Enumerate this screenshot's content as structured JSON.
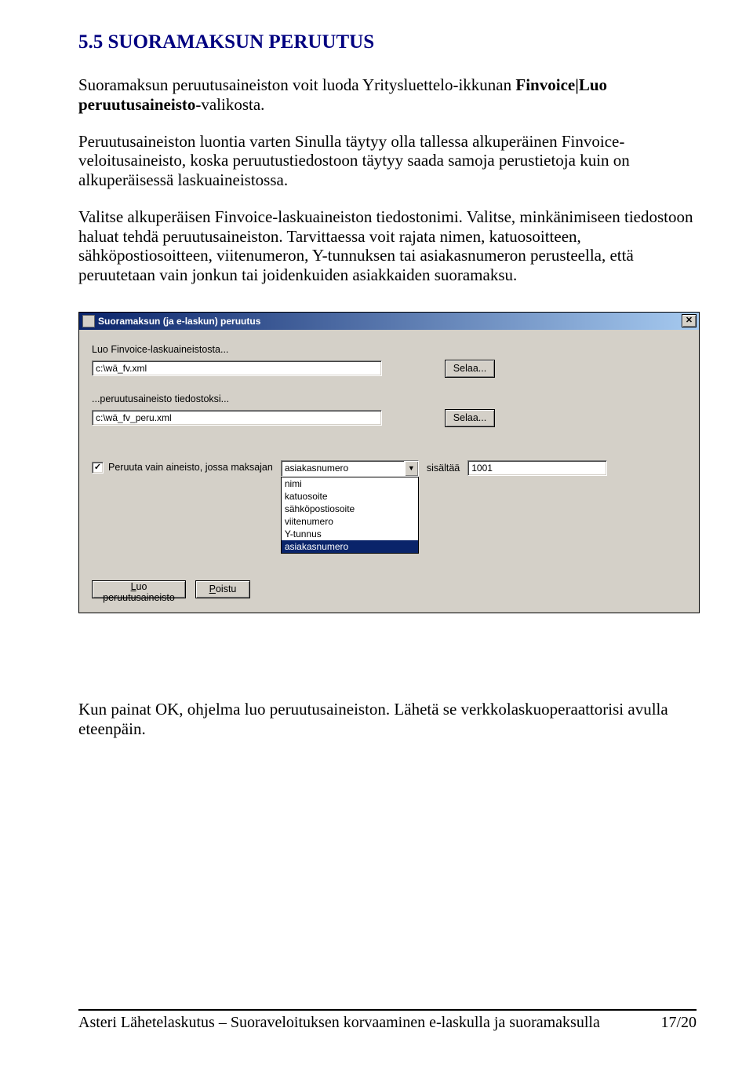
{
  "heading": "5.5 SUORAMAKSUN PERUUTUS",
  "para1_a": "Suoramaksun peruutusaineiston voit luoda Yritysluettelo-ikkunan ",
  "para1_b": "Finvoice|Luo peruutusaineisto",
  "para1_c": "-valikosta.",
  "para2": "Peruutusaineiston luontia varten Sinulla täytyy olla tallessa alkuperäinen Finvoice-veloitusaineisto, koska peruutustiedostoon täytyy saada samoja perustietoja kuin on alkuperäisessä laskuaineistossa.",
  "para3": "Valitse alkuperäisen Finvoice-laskuaineiston tiedostonimi. Valitse, minkänimiseen tiedostoon haluat tehdä peruutusaineiston. Tarvittaessa voit rajata nimen, katuosoitteen, sähköpostiosoitteen, viitenumeron, Y-tunnuksen tai asiakasnumeron perusteella, että peruutetaan vain jonkun tai joidenkuiden asiakkaiden suoramaksu.",
  "dialog": {
    "title": "Suoramaksun (ja e-laskun) peruutus",
    "close_symbol": "✕",
    "label1": "Luo Finvoice-laskuaineistosta...",
    "input1": "c:\\wä_fv.xml",
    "browse1": "Selaa...",
    "label2": "...peruutusaineisto tiedostoksi...",
    "input2": "c:\\wä_fv_peru.xml",
    "browse2": "Selaa...",
    "check_mark": "✓",
    "check_label": "Peruuta vain aineisto, jossa maksajan",
    "combo_value": "asiakasnumero",
    "combo_arrow": "▼",
    "options": [
      {
        "label": "nimi",
        "selected": false
      },
      {
        "label": "katuosoite",
        "selected": false
      },
      {
        "label": "sähköpostiosoite",
        "selected": false
      },
      {
        "label": "viitenumero",
        "selected": false
      },
      {
        "label": "Y-tunnus",
        "selected": false
      },
      {
        "label": "asiakasnumero",
        "selected": true
      }
    ],
    "sisaltaa": "sisältää",
    "filter_value": "1001",
    "btn_create_a": "L",
    "btn_create_b": "uo peruutusaineisto",
    "btn_exit_a": "P",
    "btn_exit_b": "oistu"
  },
  "para4": "Kun painat OK, ohjelma luo peruutusaineiston. Lähetä se verkkolaskuoperaattorisi avulla eteenpäin.",
  "footer_left": "Asteri Lähetelaskutus – Suoraveloituksen korvaaminen e-laskulla ja suoramaksulla",
  "footer_right": "17/20"
}
